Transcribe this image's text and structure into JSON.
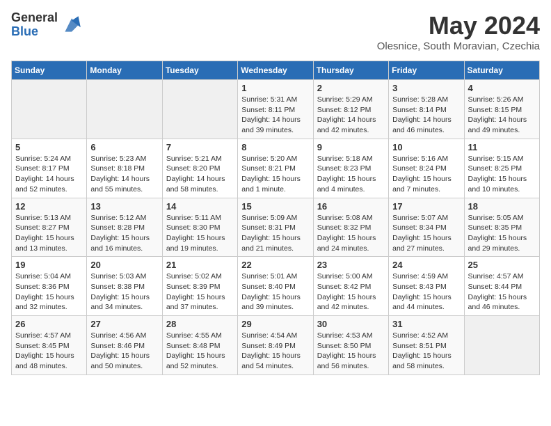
{
  "header": {
    "logo_general": "General",
    "logo_blue": "Blue",
    "month_title": "May 2024",
    "subtitle": "Olesnice, South Moravian, Czechia"
  },
  "weekdays": [
    "Sunday",
    "Monday",
    "Tuesday",
    "Wednesday",
    "Thursday",
    "Friday",
    "Saturday"
  ],
  "weeks": [
    [
      {
        "day": "",
        "info": ""
      },
      {
        "day": "",
        "info": ""
      },
      {
        "day": "",
        "info": ""
      },
      {
        "day": "1",
        "info": "Sunrise: 5:31 AM\nSunset: 8:11 PM\nDaylight: 14 hours and 39 minutes."
      },
      {
        "day": "2",
        "info": "Sunrise: 5:29 AM\nSunset: 8:12 PM\nDaylight: 14 hours and 42 minutes."
      },
      {
        "day": "3",
        "info": "Sunrise: 5:28 AM\nSunset: 8:14 PM\nDaylight: 14 hours and 46 minutes."
      },
      {
        "day": "4",
        "info": "Sunrise: 5:26 AM\nSunset: 8:15 PM\nDaylight: 14 hours and 49 minutes."
      }
    ],
    [
      {
        "day": "5",
        "info": "Sunrise: 5:24 AM\nSunset: 8:17 PM\nDaylight: 14 hours and 52 minutes."
      },
      {
        "day": "6",
        "info": "Sunrise: 5:23 AM\nSunset: 8:18 PM\nDaylight: 14 hours and 55 minutes."
      },
      {
        "day": "7",
        "info": "Sunrise: 5:21 AM\nSunset: 8:20 PM\nDaylight: 14 hours and 58 minutes."
      },
      {
        "day": "8",
        "info": "Sunrise: 5:20 AM\nSunset: 8:21 PM\nDaylight: 15 hours and 1 minute."
      },
      {
        "day": "9",
        "info": "Sunrise: 5:18 AM\nSunset: 8:23 PM\nDaylight: 15 hours and 4 minutes."
      },
      {
        "day": "10",
        "info": "Sunrise: 5:16 AM\nSunset: 8:24 PM\nDaylight: 15 hours and 7 minutes."
      },
      {
        "day": "11",
        "info": "Sunrise: 5:15 AM\nSunset: 8:25 PM\nDaylight: 15 hours and 10 minutes."
      }
    ],
    [
      {
        "day": "12",
        "info": "Sunrise: 5:13 AM\nSunset: 8:27 PM\nDaylight: 15 hours and 13 minutes."
      },
      {
        "day": "13",
        "info": "Sunrise: 5:12 AM\nSunset: 8:28 PM\nDaylight: 15 hours and 16 minutes."
      },
      {
        "day": "14",
        "info": "Sunrise: 5:11 AM\nSunset: 8:30 PM\nDaylight: 15 hours and 19 minutes."
      },
      {
        "day": "15",
        "info": "Sunrise: 5:09 AM\nSunset: 8:31 PM\nDaylight: 15 hours and 21 minutes."
      },
      {
        "day": "16",
        "info": "Sunrise: 5:08 AM\nSunset: 8:32 PM\nDaylight: 15 hours and 24 minutes."
      },
      {
        "day": "17",
        "info": "Sunrise: 5:07 AM\nSunset: 8:34 PM\nDaylight: 15 hours and 27 minutes."
      },
      {
        "day": "18",
        "info": "Sunrise: 5:05 AM\nSunset: 8:35 PM\nDaylight: 15 hours and 29 minutes."
      }
    ],
    [
      {
        "day": "19",
        "info": "Sunrise: 5:04 AM\nSunset: 8:36 PM\nDaylight: 15 hours and 32 minutes."
      },
      {
        "day": "20",
        "info": "Sunrise: 5:03 AM\nSunset: 8:38 PM\nDaylight: 15 hours and 34 minutes."
      },
      {
        "day": "21",
        "info": "Sunrise: 5:02 AM\nSunset: 8:39 PM\nDaylight: 15 hours and 37 minutes."
      },
      {
        "day": "22",
        "info": "Sunrise: 5:01 AM\nSunset: 8:40 PM\nDaylight: 15 hours and 39 minutes."
      },
      {
        "day": "23",
        "info": "Sunrise: 5:00 AM\nSunset: 8:42 PM\nDaylight: 15 hours and 42 minutes."
      },
      {
        "day": "24",
        "info": "Sunrise: 4:59 AM\nSunset: 8:43 PM\nDaylight: 15 hours and 44 minutes."
      },
      {
        "day": "25",
        "info": "Sunrise: 4:57 AM\nSunset: 8:44 PM\nDaylight: 15 hours and 46 minutes."
      }
    ],
    [
      {
        "day": "26",
        "info": "Sunrise: 4:57 AM\nSunset: 8:45 PM\nDaylight: 15 hours and 48 minutes."
      },
      {
        "day": "27",
        "info": "Sunrise: 4:56 AM\nSunset: 8:46 PM\nDaylight: 15 hours and 50 minutes."
      },
      {
        "day": "28",
        "info": "Sunrise: 4:55 AM\nSunset: 8:48 PM\nDaylight: 15 hours and 52 minutes."
      },
      {
        "day": "29",
        "info": "Sunrise: 4:54 AM\nSunset: 8:49 PM\nDaylight: 15 hours and 54 minutes."
      },
      {
        "day": "30",
        "info": "Sunrise: 4:53 AM\nSunset: 8:50 PM\nDaylight: 15 hours and 56 minutes."
      },
      {
        "day": "31",
        "info": "Sunrise: 4:52 AM\nSunset: 8:51 PM\nDaylight: 15 hours and 58 minutes."
      },
      {
        "day": "",
        "info": ""
      }
    ]
  ]
}
